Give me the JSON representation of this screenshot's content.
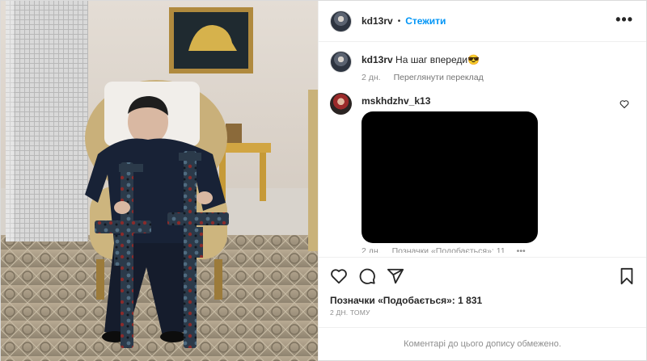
{
  "post": {
    "username": "kd13rv",
    "separator": "•",
    "follow_label": "Стежити",
    "more_label": "•••"
  },
  "caption": {
    "username": "kd13rv",
    "text": "На шаг впереди😎",
    "time": "2 дн.",
    "translate_label": "Переглянути переклад"
  },
  "comment": {
    "username": "mskhdzhv_k13",
    "time": "2 дн.",
    "likes_label": "Позначки «Подобається»: 11",
    "more_label": "•••"
  },
  "actions": {
    "icons": [
      "heart-icon",
      "comment-icon",
      "share-icon",
      "bookmark-icon"
    ],
    "likes_text": "Позначки «Подобається»: 1 831",
    "date_text": "2 ДН. ТОМУ"
  },
  "footer": {
    "text": "Коментарі до цього допису обмежено."
  },
  "colors": {
    "accent": "#0095f6",
    "text": "#262626",
    "secondary": "#8e8e8e",
    "border": "#dbdbdb"
  }
}
